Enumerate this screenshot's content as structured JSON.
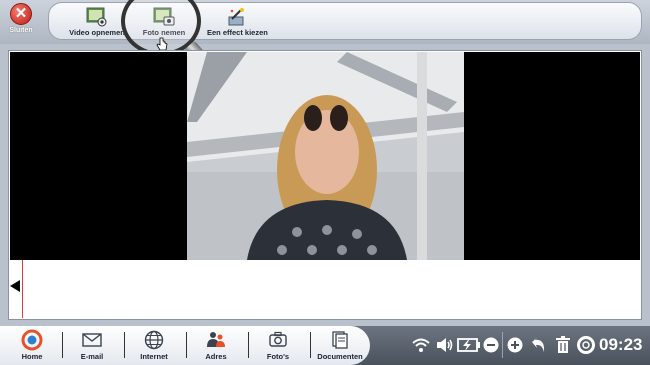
{
  "close": {
    "label": "Sluiten"
  },
  "toolbar": {
    "items": [
      {
        "label": "Video opnemen",
        "icon": "video-camera-icon"
      },
      {
        "label": "Foto nemen",
        "icon": "photo-camera-icon"
      },
      {
        "label": "Een effect kiezen",
        "icon": "magic-wand-icon"
      }
    ]
  },
  "taskbar": {
    "items": [
      {
        "label": "Home",
        "icon": "home-icon"
      },
      {
        "label": "E-mail",
        "icon": "envelope-icon"
      },
      {
        "label": "Internet",
        "icon": "globe-icon"
      },
      {
        "label": "Adres",
        "icon": "address-book-icon"
      },
      {
        "label": "Foto's",
        "icon": "camera-icon"
      },
      {
        "label": "Documenten",
        "icon": "documents-icon"
      }
    ]
  },
  "status": {
    "clock": "09:23"
  },
  "colors": {
    "close_red": "#c21b12",
    "taskbar_dark": "#4a525c",
    "accent_orange": "#e8502a"
  }
}
